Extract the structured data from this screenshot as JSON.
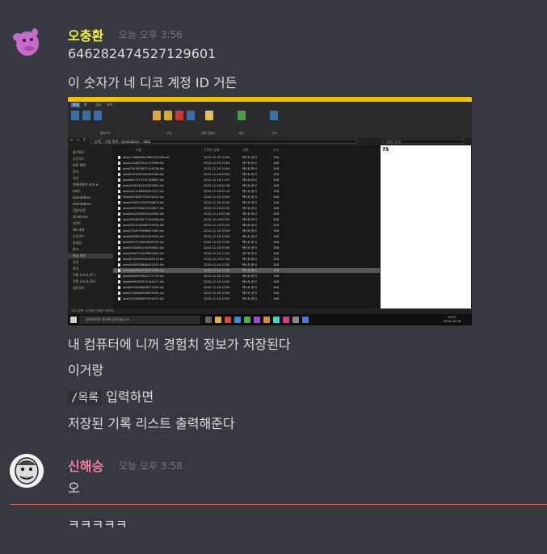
{
  "messages": [
    {
      "username": "오충환",
      "username_color": "#f0f04a",
      "timestamp": "오늘 오후 3:56",
      "lines": [
        "646282474527129601",
        "이 숫자가 네 디코 계정 ID 거든"
      ],
      "lines_after_image": [
        "내 컴퓨터에 니꺼 경험치 정보가 저장된다",
        "이거랑"
      ],
      "command": "/목록",
      "command_suffix": "입력하면",
      "final_line": "저장된 기록 리스트 출력해준다"
    },
    {
      "username": "신해승",
      "username_color": "#f47fa4",
      "timestamp": "오늘 오후 3:58",
      "lines": [
        "오"
      ]
    }
  ],
  "trailing_message": "ㅋㅋㅋㅋㅋ",
  "screenshot": {
    "window_title": "data",
    "tabs": [
      "파일",
      "홈",
      "공유",
      "보기"
    ],
    "ribbon_groups": [
      "클립보드",
      "구성",
      "새로 만들기",
      "열기",
      "선택"
    ],
    "address_path": "내 PC › 바탕 화면 › bluelatbser › data",
    "search_placeholder": "data 검색",
    "columns": [
      "이름",
      "수정한 날짜",
      "유형",
      "크기"
    ],
    "nav_items": [
      "즐겨찾기",
      "다운로드",
      "바탕 화면",
      "문서",
      "사진",
      "현재대화로 교대 ★",
      "data",
      "bluelatbser",
      "bluelatbser",
      "경험치/문",
      "OneDrive",
      "내 PC",
      "3D 개체",
      "다운로드",
      "동영상",
      "문서",
      "바탕 화면",
      "사진",
      "음악",
      "로컬 디스크 (C:)",
      "로컬 디스크 (D:)",
      "네트워크"
    ],
    "files": [
      {
        "name": "data1198865847684032398.txt",
        "date": "2020-12-16 15:00",
        "type": "텍스트 문서",
        "size": "1KB"
      },
      {
        "name": "data1125807041237998.txt",
        "date": "2020-12-16 14:00",
        "type": "텍스트 문서",
        "size": "1KB"
      },
      {
        "name": "data2341953871918138.txt",
        "date": "2020-12-16 14:00",
        "type": "텍스트 문서",
        "size": "1KB"
      },
      {
        "name": "data2341485163440783.txt",
        "date": "2020-12-16 00:55",
        "type": "텍스트 문서",
        "size": "1KB"
      },
      {
        "name": "data2621773737105897.txt",
        "date": "2020-12-16 11:57",
        "type": "텍스트 문서",
        "size": "1KB"
      },
      {
        "name": "data2630761415252883.txt",
        "date": "2020-12-16 00:38",
        "type": "텍스트 문서",
        "size": "1KB"
      },
      {
        "name": "data2627448985552077.txt",
        "date": "2020-12-16 00:16",
        "type": "텍스트 문서",
        "size": "1KB"
      },
      {
        "name": "data2631061794215414.txt",
        "date": "2020-12-16 15:00",
        "type": "텍스트 문서",
        "size": "1KB"
      },
      {
        "name": "data2630912567408813.txt",
        "date": "2020-12-16 15:00",
        "type": "텍스트 문서",
        "size": "1KB"
      },
      {
        "name": "data2632794413159007.txt",
        "date": "2020-12-16 00:33",
        "type": "텍스트 문서",
        "size": "1KB"
      },
      {
        "name": "data2632585901000348.txt",
        "date": "2020-12-16 00:38",
        "type": "텍스트 문서",
        "size": "1KB"
      },
      {
        "name": "data2634845271950508.txt",
        "date": "2020-12-16 00:33",
        "type": "텍스트 문서",
        "size": "1KB"
      },
      {
        "name": "data2641936386734530.txt",
        "date": "2020-12-16 00:24",
        "type": "텍스트 문서",
        "size": "1KB"
      },
      {
        "name": "data2704979466051580.txt",
        "date": "2020-12-16 15:00",
        "type": "텍스트 문서",
        "size": "1KB"
      },
      {
        "name": "data2809891951001944.txt",
        "date": "2020-12-16 15:00",
        "type": "텍스트 문서",
        "size": "1KB"
      },
      {
        "name": "data3097210604060230.txt",
        "date": "2020-12-16 15:00",
        "type": "텍스트 문서",
        "size": "1KB"
      },
      {
        "name": "data3258084118705601.txt",
        "date": "2020-12-16 15:00",
        "type": "텍스트 문서",
        "size": "1KB"
      },
      {
        "name": "data3460719439085409.txt",
        "date": "2020-12-16 11:50",
        "type": "텍스트 문서",
        "size": "1KB"
      },
      {
        "name": "data3740890048109473.txt",
        "date": "2020-12-16 00:33",
        "type": "텍스트 문서",
        "size": "1KB"
      },
      {
        "name": "data4050918660042025.txt",
        "date": "2020-12-16 15:00",
        "type": "텍스트 문서",
        "size": "1KB"
      },
      {
        "name": "data4462824745271296.txt",
        "date": "2020-12-16 15:00",
        "type": "텍스트 문서",
        "size": "1KB",
        "selected": true
      },
      {
        "name": "data4649991621271770.txt",
        "date": "2020-12-16 15:00",
        "type": "텍스트 문서",
        "size": "1KB"
      },
      {
        "name": "data6490267915144017.txt",
        "date": "2020-12-16 15:00",
        "type": "텍스트 문서",
        "size": "1KB"
      },
      {
        "name": "data6594564698070559.txt",
        "date": "2020-12-16 15:00",
        "type": "텍스트 문서",
        "size": "1KB"
      },
      {
        "name": "data7126089328924945.txt",
        "date": "2020-12-16 15:00",
        "type": "텍스트 문서",
        "size": "1KB"
      },
      {
        "name": "data7931864955024915.txt",
        "date": "2020-12-16 15:00",
        "type": "텍스트 문서",
        "size": "1KB"
      }
    ],
    "preview_text": "75",
    "status_text": "26개 항목   1개 항목 선택함 2바이트",
    "taskbar_search": "검색하려면 여기에 입력하십시오",
    "clock_time": "15:57",
    "clock_date": "2020-12-16"
  }
}
